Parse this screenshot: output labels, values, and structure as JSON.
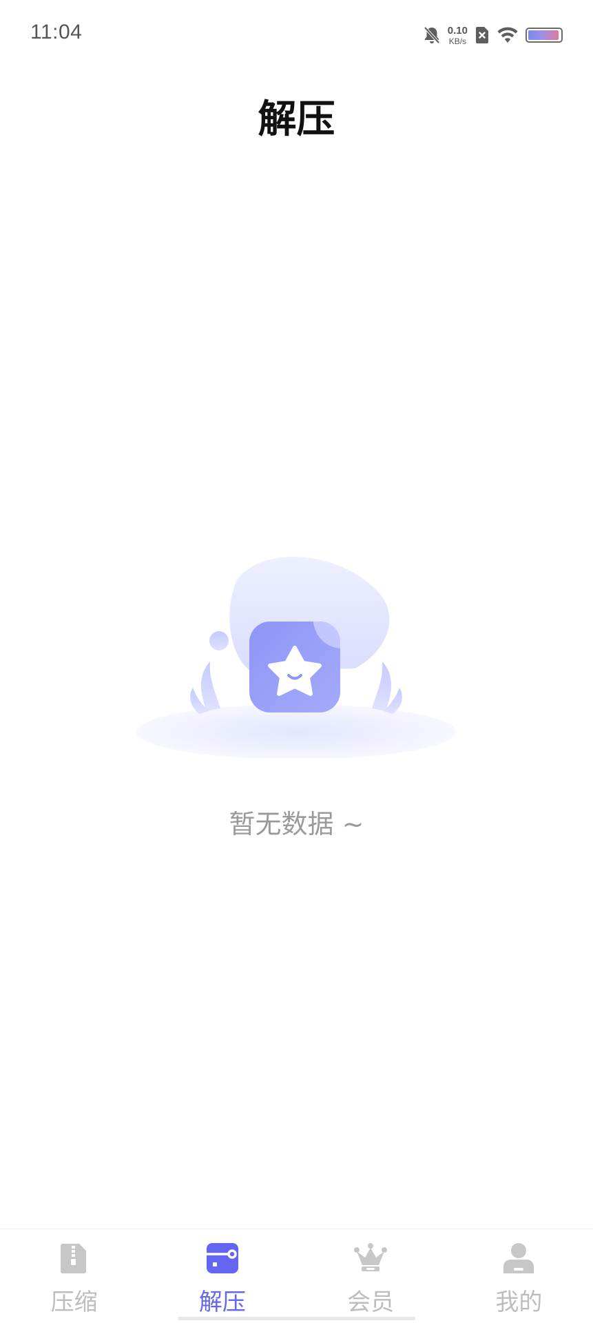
{
  "status_bar": {
    "time": "11:04",
    "net_speed_value": "0.10",
    "net_speed_unit": "KB/s",
    "icons": [
      "bell-off-icon",
      "no-sim-icon",
      "wifi-icon",
      "battery-icon"
    ],
    "battery_level_percent": 95
  },
  "header": {
    "title": "解压"
  },
  "empty_state": {
    "illustration": "empty-star-box-illustration",
    "text": "暂无数据 ~"
  },
  "tab_bar": {
    "active_index": 1,
    "tabs": [
      {
        "label": "压缩",
        "icon": "zip-file-icon"
      },
      {
        "label": "解压",
        "icon": "unzip-box-icon"
      },
      {
        "label": "会员",
        "icon": "crown-icon"
      },
      {
        "label": "我的",
        "icon": "user-icon"
      }
    ]
  },
  "colors": {
    "accent": "#6466f1",
    "inactive_tab": "#bdbdbd",
    "empty_text": "#9a9a9a",
    "illustration_primary": "#8f97f6"
  }
}
